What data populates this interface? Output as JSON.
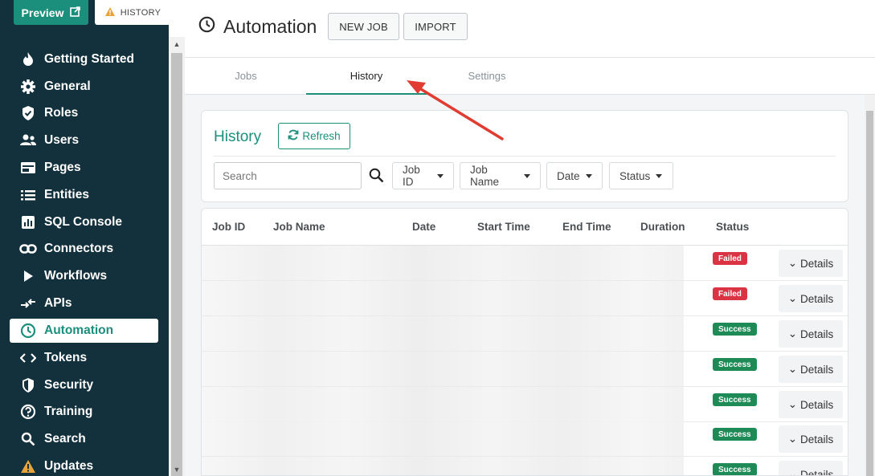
{
  "sidebar": {
    "preview_label": "Preview",
    "history_label": "HISTORY",
    "items": [
      {
        "label": "Getting Started",
        "icon": "flame-icon"
      },
      {
        "label": "General",
        "icon": "gear-icon"
      },
      {
        "label": "Roles",
        "icon": "shield-check-icon"
      },
      {
        "label": "Users",
        "icon": "users-icon"
      },
      {
        "label": "Pages",
        "icon": "pages-icon"
      },
      {
        "label": "Entities",
        "icon": "list-icon"
      },
      {
        "label": "SQL Console",
        "icon": "chart-icon"
      },
      {
        "label": "Connectors",
        "icon": "link-icon"
      },
      {
        "label": "Workflows",
        "icon": "play-icon"
      },
      {
        "label": "APIs",
        "icon": "api-icon"
      },
      {
        "label": "Automation",
        "icon": "clock-icon",
        "active": true
      },
      {
        "label": "Tokens",
        "icon": "code-icon"
      },
      {
        "label": "Security",
        "icon": "shield-icon"
      },
      {
        "label": "Training",
        "icon": "help-icon"
      },
      {
        "label": "Search",
        "icon": "search-icon"
      },
      {
        "label": "Updates",
        "icon": "warning-icon"
      }
    ]
  },
  "header": {
    "title": "Automation",
    "new_job_label": "NEW JOB",
    "import_label": "IMPORT"
  },
  "tabs": [
    {
      "label": "Jobs"
    },
    {
      "label": "History",
      "active": true
    },
    {
      "label": "Settings"
    }
  ],
  "history": {
    "title": "History",
    "refresh_label": "Refresh",
    "search_placeholder": "Search",
    "filters": [
      "Job ID",
      "Job Name",
      "Date",
      "Status"
    ]
  },
  "table": {
    "columns": [
      "Job ID",
      "Job Name",
      "Date",
      "Start Time",
      "End Time",
      "Duration",
      "Status"
    ],
    "details_label": "Details",
    "rows": [
      {
        "status": "Failed"
      },
      {
        "status": "Failed"
      },
      {
        "status": "Success"
      },
      {
        "status": "Success"
      },
      {
        "status": "Success"
      },
      {
        "status": "Success"
      },
      {
        "status": "Success"
      }
    ]
  },
  "colors": {
    "sidebar_bg": "#13303d",
    "accent": "#1b8f7c",
    "failed": "#d93344",
    "success": "#1e8a55",
    "annotation_arrow": "#e03c31"
  }
}
